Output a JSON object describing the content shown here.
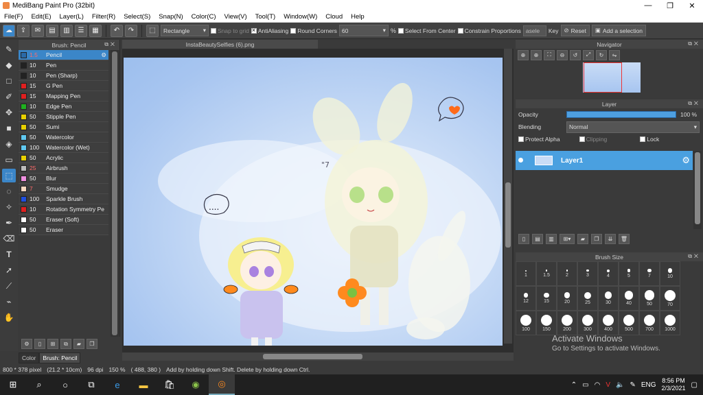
{
  "window": {
    "title": "MediBang Paint Pro (32bit)",
    "minimize": "—",
    "restore": "❐",
    "close": "✕"
  },
  "menu": [
    "File(F)",
    "Edit(E)",
    "Layer(L)",
    "Filter(R)",
    "Select(S)",
    "Snap(N)",
    "Color(C)",
    "View(V)",
    "Tool(T)",
    "Window(W)",
    "Cloud",
    "Help"
  ],
  "toolbar": {
    "shape_select": "Rectangle",
    "snap_to_grid": "Snap to grid",
    "antialiasing": "AntiAliasing",
    "round_corners": "Round Corners",
    "round_value": "60",
    "percent": "%",
    "select_from_center": "Select From Center",
    "constrain": "Constrain Proportions",
    "aspect_placeholder": "asele",
    "key": "Key",
    "reset": "Reset",
    "add_selection": "Add a selection"
  },
  "brush_panel": {
    "title": "Brush: Pencil",
    "brushes": [
      {
        "size": "1.5",
        "name": "Pencil",
        "color": "#2a6aa8",
        "red": true,
        "selected": true
      },
      {
        "size": "10",
        "name": "Pen",
        "color": "#222222"
      },
      {
        "size": "10",
        "name": "Pen (Sharp)",
        "color": "#222222"
      },
      {
        "size": "15",
        "name": "G Pen",
        "color": "#e02020"
      },
      {
        "size": "15",
        "name": "Mapping Pen",
        "color": "#e02020"
      },
      {
        "size": "10",
        "name": "Edge Pen",
        "color": "#20b020"
      },
      {
        "size": "50",
        "name": "Stipple Pen",
        "color": "#e8d000"
      },
      {
        "size": "50",
        "name": "Sumi",
        "color": "#e8d000"
      },
      {
        "size": "50",
        "name": "Watercolor",
        "color": "#60c8f0"
      },
      {
        "size": "100",
        "name": "Watercolor (Wet)",
        "color": "#60c8f0"
      },
      {
        "size": "50",
        "name": "Acrylic",
        "color": "#e8d000"
      },
      {
        "size": "25",
        "name": "Airbrush",
        "color": "#bbbbbb",
        "red": true
      },
      {
        "size": "50",
        "name": "Blur",
        "color": "#f090e0"
      },
      {
        "size": "7",
        "name": "Smudge",
        "color": "#f8d8c0",
        "red": true
      },
      {
        "size": "100",
        "name": "Sparkle Brush",
        "color": "#2050e0"
      },
      {
        "size": "10",
        "name": "Rotation Symmetry Pe",
        "color": "#e02020"
      },
      {
        "size": "50",
        "name": "Eraser (Soft)",
        "color": "#ffffff"
      },
      {
        "size": "50",
        "name": "Eraser",
        "color": "#ffffff"
      }
    ],
    "tabs": [
      "Color",
      "Brush: Pencil"
    ]
  },
  "document": {
    "tab": "InstaBeautySelfies (6).png"
  },
  "status": {
    "size": "800 * 378 pixel",
    "physical": "(21.2 * 10cm)",
    "dpi": "96 dpi",
    "zoom": "150 %",
    "coords": "( 488, 380 )",
    "hint": "Add by holding down Shift. Delete by holding down Ctrl."
  },
  "navigator": {
    "title": "Navigator"
  },
  "layer_panel": {
    "title": "Layer",
    "opacity_label": "Opacity",
    "opacity_value": "100 %",
    "opacity_level": 1.0,
    "blending_label": "Blending",
    "blending_value": "Normal",
    "protect_alpha": "Protect Alpha",
    "clipping": "Clipping",
    "lock": "Lock",
    "layer_name": "Layer1"
  },
  "brush_size": {
    "title": "Brush Size",
    "sizes": [
      "1",
      "1.5",
      "2",
      "3",
      "4",
      "5",
      "7",
      "10",
      "12",
      "15",
      "20",
      "25",
      "30",
      "40",
      "50",
      "70",
      "100",
      "150",
      "200",
      "300",
      "400",
      "500",
      "700",
      "1000"
    ],
    "activate_1": "Activate Windows",
    "activate_2": "Go to Settings to activate Windows."
  },
  "taskbar": {
    "language": "ENG",
    "time": "8:56 PM",
    "date": "2/3/2021"
  },
  "artwork": {
    "speech_dots": "....",
    "mark": "\"7"
  }
}
